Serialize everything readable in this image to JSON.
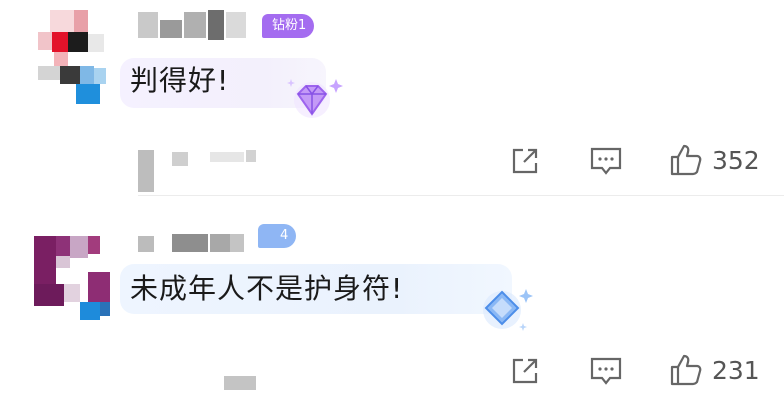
{
  "comments": [
    {
      "badge": {
        "label": "钻粉1",
        "color": "#a46cf0"
      },
      "text": "判得好!",
      "gem_icon": "diamond-gem-icon",
      "actions": {
        "share_icon": "share-icon",
        "reply_icon": "comment-icon",
        "like_icon": "thumbs-up-icon",
        "likes": "352"
      }
    },
    {
      "badge": {
        "label": "4",
        "color": "#8fb6f4"
      },
      "text": "未成年人不是护身符!",
      "gem_icon": "blue-gem-icon",
      "actions": {
        "share_icon": "share-icon",
        "reply_icon": "comment-icon",
        "like_icon": "thumbs-up-icon",
        "likes": "231"
      }
    }
  ]
}
